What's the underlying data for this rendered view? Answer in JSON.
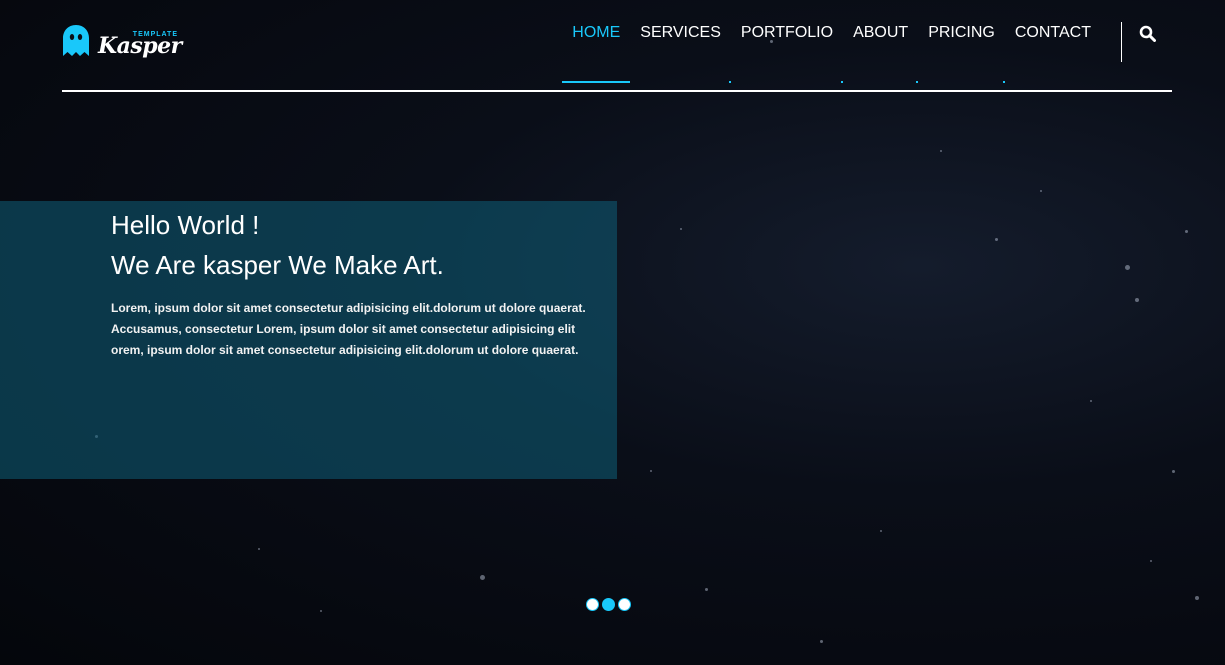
{
  "brand": {
    "name": "Kasper",
    "tagline": "TEMPLATE",
    "accent_color": "#19c8fa",
    "logo_icon": "ghost-icon"
  },
  "nav": {
    "items": [
      {
        "label": "HOME",
        "active": true
      },
      {
        "label": "SERVICES",
        "active": false
      },
      {
        "label": "PORTFOLIO",
        "active": false
      },
      {
        "label": "ABOUT",
        "active": false
      },
      {
        "label": "PRICING",
        "active": false
      },
      {
        "label": "CONTACT",
        "active": false
      }
    ],
    "search_icon": "search-icon"
  },
  "hero": {
    "title_line1": "Hello World !",
    "title_line2": "We Are kasper We Make Art.",
    "text_line1": "Lorem, ipsum dolor sit amet consectetur adipisicing elit.dolorum ut dolore quaerat.",
    "text_line2": "Accusamus, consectetur Lorem, ipsum dolor sit amet consectetur adipisicing elit",
    "text_line3": "orem, ipsum dolor sit amet consectetur adipisicing elit.dolorum ut dolore quaerat."
  },
  "slider": {
    "count": 3,
    "active_index": 1
  }
}
